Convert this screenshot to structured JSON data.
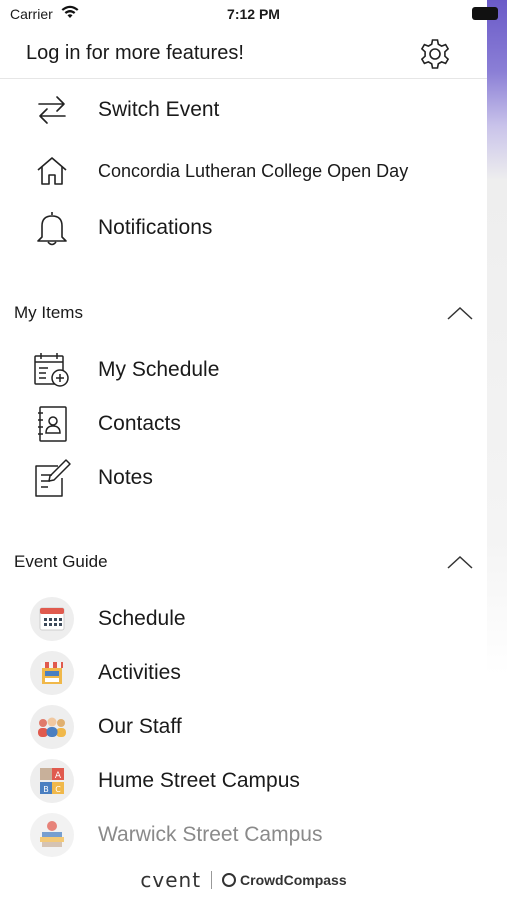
{
  "status_bar": {
    "carrier": "Carrier",
    "time": "7:12 PM",
    "icons": [
      "wifi-icon",
      "battery-icon"
    ]
  },
  "header": {
    "title": "Log in for more features!",
    "settings_icon": "gear-icon"
  },
  "top_menu": [
    {
      "label": "Switch Event",
      "icon": "switch-arrows-icon"
    },
    {
      "label": "Concordia Lutheran College Open Day",
      "icon": "home-icon"
    },
    {
      "label": "Notifications",
      "icon": "bell-icon"
    }
  ],
  "my_items": {
    "title": "My Items",
    "expanded": true,
    "items": [
      {
        "label": "My Schedule",
        "icon": "calendar-add-icon"
      },
      {
        "label": "Contacts",
        "icon": "contacts-book-icon"
      },
      {
        "label": "Notes",
        "icon": "note-pencil-icon"
      }
    ]
  },
  "event_guide": {
    "title": "Event Guide",
    "expanded": true,
    "items": [
      {
        "label": "Schedule",
        "icon": "calendar-icon"
      },
      {
        "label": "Activities",
        "icon": "market-stall-icon"
      },
      {
        "label": "Our Staff",
        "icon": "people-icon"
      },
      {
        "label": "Hume Street Campus",
        "icon": "abc-blocks-icon"
      },
      {
        "label": "Warwick Street Campus",
        "icon": "books-apple-icon"
      }
    ]
  },
  "footer": {
    "brand": "cvent",
    "product": "CrowdCompass"
  },
  "colors": {
    "accent_strip": "#6a5ac8",
    "text": "#1a1a1a",
    "divider": "#e6e6e6"
  }
}
